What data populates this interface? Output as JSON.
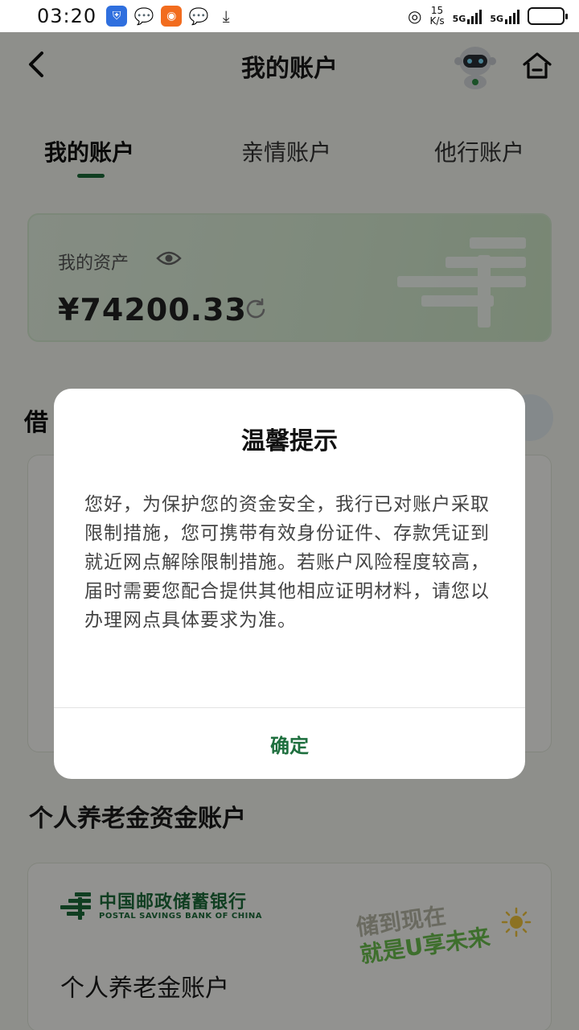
{
  "status_bar": {
    "time": "03:20",
    "net_speed_top": "15",
    "net_speed_unit": "K/s",
    "signal1": "5G",
    "signal2": "5G",
    "battery_level": 0.3
  },
  "header": {
    "title": "我的账户"
  },
  "tabs": [
    {
      "label": "我的账户",
      "active": true
    },
    {
      "label": "亲情账户",
      "active": false
    },
    {
      "label": "他行账户",
      "active": false
    }
  ],
  "asset_card": {
    "label": "我的资产",
    "value": "¥74200.33"
  },
  "debit_section": {
    "heading_partial": "借"
  },
  "pension": {
    "heading": "个人养老金资金账户",
    "bank_name_cn": "中国邮政储蓄银行",
    "bank_name_en": "POSTAL SAVINGS BANK OF CHINA",
    "slogan_line1": "储到现在",
    "slogan_line2": "就是U享未来",
    "account_title": "个人养老金账户"
  },
  "dialog": {
    "title": "温馨提示",
    "body": "您好，为保护您的资金安全，我行已对账户采取限制措施，您可携带有效身份证件、存款凭证到就近网点解除限制措施。若账户风险程度较高，届时需要您配合提供其他相应证明材料，请您以办理网点具体要求为准。",
    "confirm_label": "确定"
  },
  "colors": {
    "brand_green": "#1e6f3e",
    "overlay": "rgba(0,0,0,0.42)"
  }
}
